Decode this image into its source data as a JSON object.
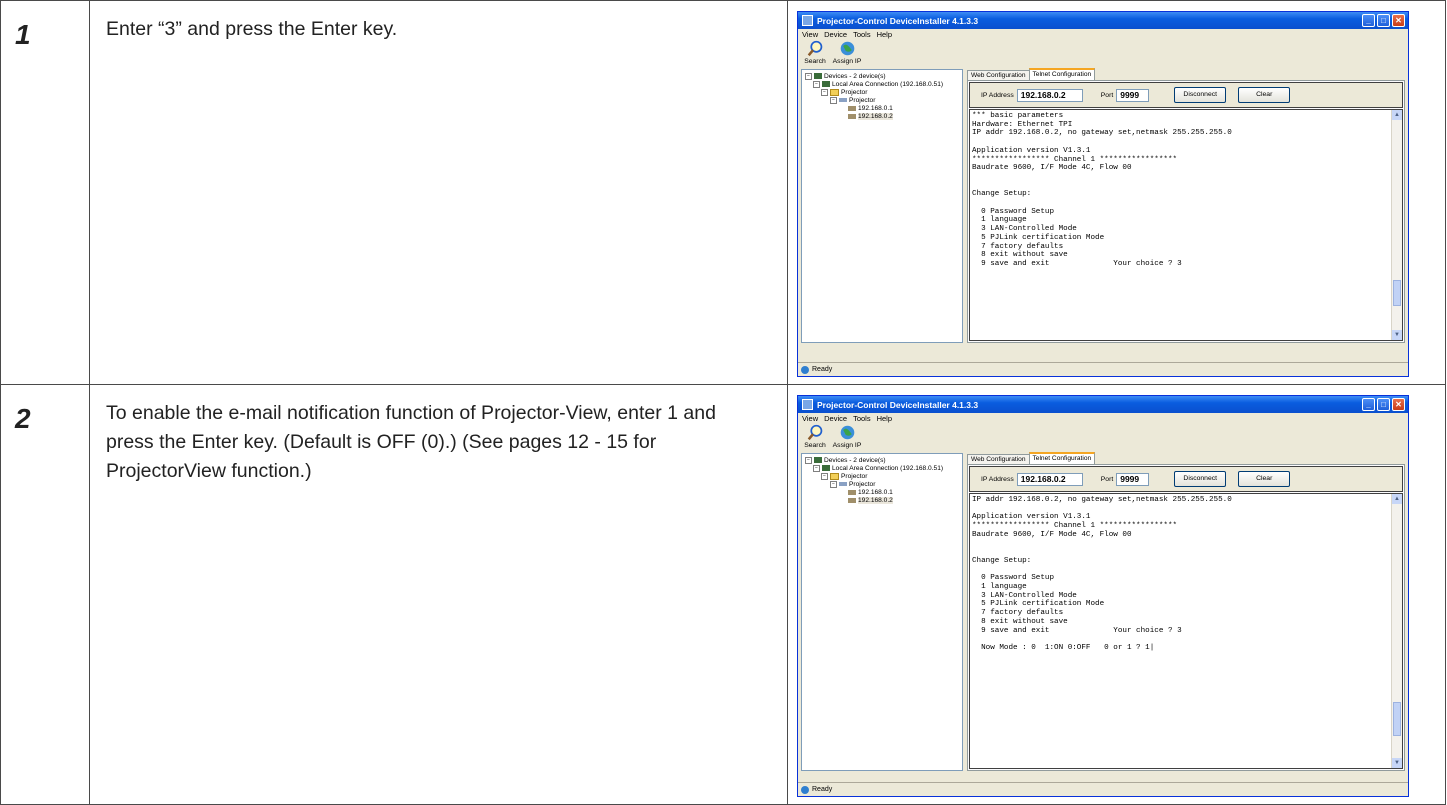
{
  "steps": [
    {
      "number": "1",
      "text": "Enter “3” and press the Enter key.",
      "window": {
        "title": "Projector-Control DeviceInstaller 4.1.3.3",
        "menu": [
          "View",
          "Device",
          "Tools",
          "Help"
        ],
        "toolbar": {
          "search": "Search",
          "assign_ip": "Assign IP"
        },
        "tree": {
          "root": "Devices - 2 device(s)",
          "connection": "Local Area Connection (192.168.0.51)",
          "group": "Projector",
          "type": "Projector",
          "device1": "192.168.0.1",
          "device2": "192.168.0.2"
        },
        "tabs": {
          "web": "Web Configuration",
          "telnet": "Telnet Configuration"
        },
        "ip_label": "IP Address",
        "ip_value": "192.168.0.2",
        "port_label": "Port",
        "port_value": "9999",
        "disconnect": "Disconnect",
        "clear": "Clear",
        "console": "*** basic parameters\nHardware: Ethernet TPI\nIP addr 192.168.0.2, no gateway set,netmask 255.255.255.0\n\nApplication version V1.3.1\n***************** Channel 1 *****************\nBaudrate 9600, I/F Mode 4C, Flow 00\n\n\nChange Setup:\n\n  0 Password Setup\n  1 language\n  3 LAN-Controlled Mode\n  5 PJLink certification Mode\n  7 factory defaults\n  8 exit without save\n  9 save and exit              Your choice ? 3",
        "status": "Ready"
      }
    },
    {
      "number": "2",
      "text": "To enable the e-mail notification function of Projector-View, enter 1 and press the Enter key. (Default is OFF (0).) (See pages 12 - 15 for ProjectorView function.)",
      "window": {
        "title": "Projector-Control DeviceInstaller 4.1.3.3",
        "menu": [
          "View",
          "Device",
          "Tools",
          "Help"
        ],
        "toolbar": {
          "search": "Search",
          "assign_ip": "Assign IP"
        },
        "tree": {
          "root": "Devices - 2 device(s)",
          "connection": "Local Area Connection (192.168.0.51)",
          "group": "Projector",
          "type": "Projector",
          "device1": "192.168.0.1",
          "device2": "192.168.0.2"
        },
        "tabs": {
          "web": "Web Configuration",
          "telnet": "Telnet Configuration"
        },
        "ip_label": "IP Address",
        "ip_value": "192.168.0.2",
        "port_label": "Port",
        "port_value": "9999",
        "disconnect": "Disconnect",
        "clear": "Clear",
        "console": "IP addr 192.168.0.2, no gateway set,netmask 255.255.255.0\n\nApplication version V1.3.1\n***************** Channel 1 *****************\nBaudrate 9600, I/F Mode 4C, Flow 00\n\n\nChange Setup:\n\n  0 Password Setup\n  1 language\n  3 LAN-Controlled Mode\n  5 PJLink certification Mode\n  7 factory defaults\n  8 exit without save\n  9 save and exit              Your choice ? 3\n\n  Now Mode : 0  1:ON 0:OFF   0 or 1 ? 1|",
        "status": "Ready"
      }
    }
  ]
}
